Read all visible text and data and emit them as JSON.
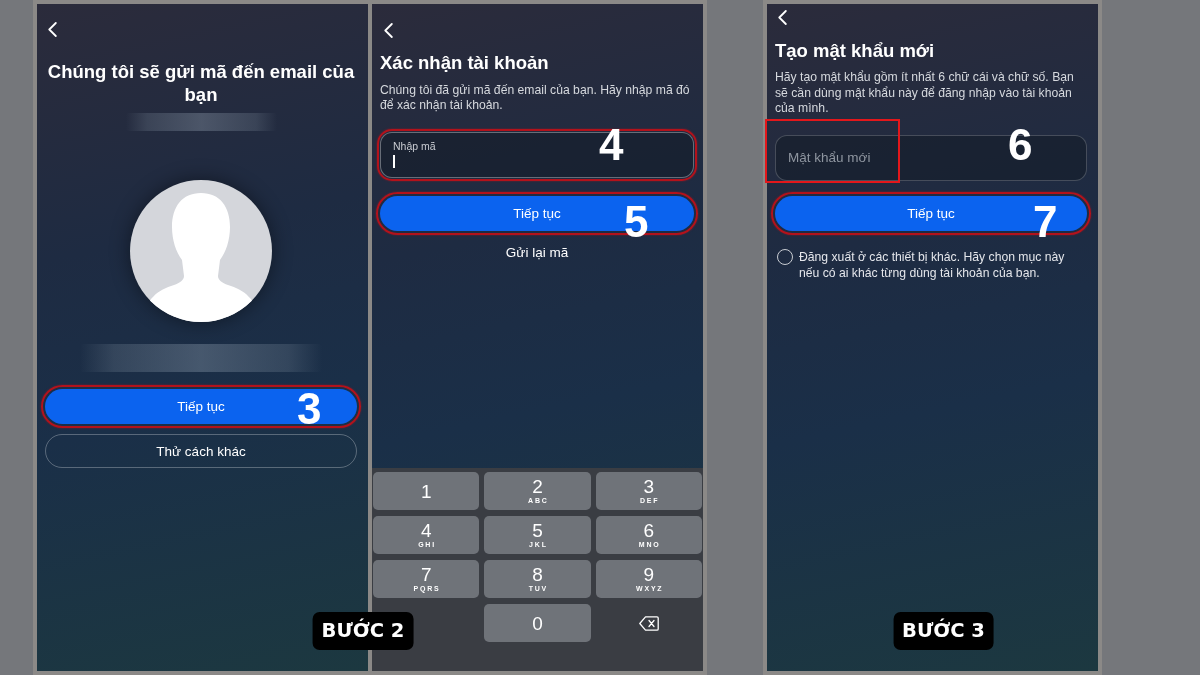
{
  "groups": [
    {
      "step_label": "BƯỚC 2",
      "screens": [
        {
          "kind": "email_prompt",
          "title": "Chúng tôi sẽ gửi mã đến email của bạn",
          "buttons": [
            {
              "label": "Tiếp tục",
              "kind": "primary",
              "annotation": {
                "kind": "ring",
                "step": "3"
              }
            },
            {
              "label": "Thử cách khác",
              "kind": "outline"
            }
          ]
        },
        {
          "kind": "code_entry",
          "title": "Xác nhận tài khoản",
          "description": "Chúng tôi đã gửi mã đến email của bạn. Hãy nhập mã đó để xác nhận tài khoản.",
          "field": {
            "label": "Nhập mã",
            "focused": true,
            "annotation": {
              "kind": "ring",
              "step": "4"
            }
          },
          "buttons": [
            {
              "label": "Tiếp tục",
              "kind": "primary",
              "annotation": {
                "kind": "ring",
                "step": "5"
              }
            },
            {
              "label": "Gửi lại mã",
              "kind": "link"
            }
          ],
          "keypad": [
            [
              {
                "kind": "digit",
                "digit": "1"
              },
              {
                "kind": "digit",
                "digit": "2",
                "letters": "ABC"
              },
              {
                "kind": "digit",
                "digit": "3",
                "letters": "DEF"
              }
            ],
            [
              {
                "kind": "digit",
                "digit": "4",
                "letters": "GHI"
              },
              {
                "kind": "digit",
                "digit": "5",
                "letters": "JKL"
              },
              {
                "kind": "digit",
                "digit": "6",
                "letters": "MNO"
              }
            ],
            [
              {
                "kind": "digit",
                "digit": "7",
                "letters": "PQRS"
              },
              {
                "kind": "digit",
                "digit": "8",
                "letters": "TUV"
              },
              {
                "kind": "digit",
                "digit": "9",
                "letters": "WXYZ"
              }
            ],
            [
              {
                "kind": "digit",
                "digit": "0"
              },
              {
                "kind": "backspace"
              }
            ]
          ]
        }
      ]
    },
    {
      "step_label": "BƯỚC 3",
      "screens": [
        {
          "kind": "new_password",
          "title": "Tạo mật khẩu mới",
          "description": "Hãy tạo mật khẩu gồm ít nhất 6 chữ cái và chữ số. Bạn sẽ cần dùng mật khẩu này để đăng nhập vào tài khoản của mình.",
          "field": {
            "placeholder": "Mật khẩu mới",
            "focused": false,
            "annotation": {
              "kind": "box",
              "step": "6"
            }
          },
          "buttons": [
            {
              "label": "Tiếp tục",
              "kind": "primary",
              "annotation": {
                "kind": "ring",
                "step": "7"
              }
            }
          ],
          "option": {
            "label": "Đăng xuất ở các thiết bị khác. Hãy chọn mục này nếu có ai khác từng dùng tài khoản của bạn.",
            "checked": false
          }
        }
      ]
    }
  ]
}
